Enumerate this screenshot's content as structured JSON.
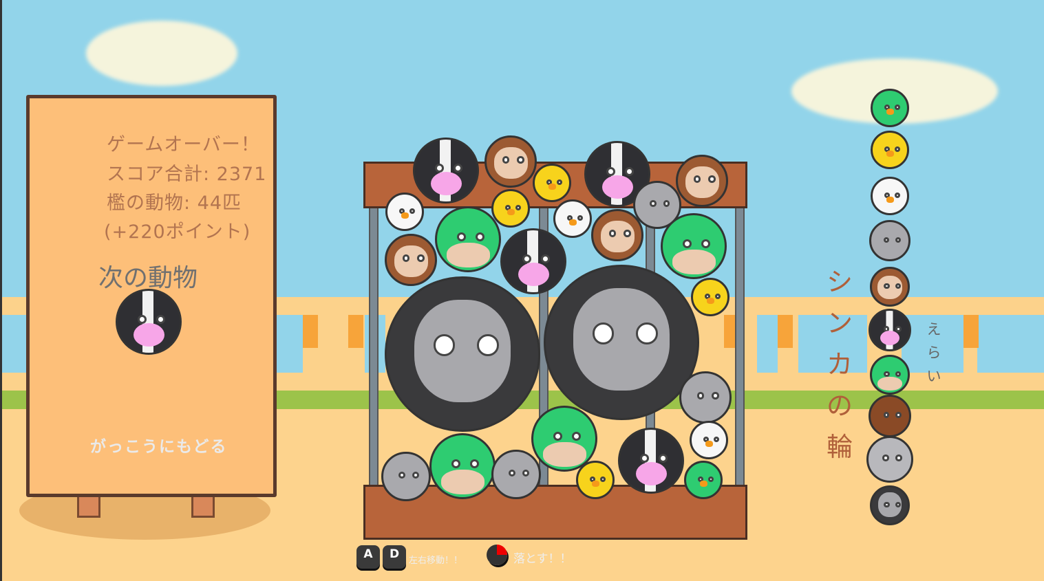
{
  "sign": {
    "game_over": "ゲームオーバー！",
    "score_total": "スコア合計: 2371",
    "cage_animals": "檻の動物: 44匹",
    "bonus": "(+220ポイント)",
    "next_label": "次の動物",
    "next_animal": "cow",
    "back_button": "がっこうにもどる"
  },
  "evolution": {
    "title_chars": [
      "シ",
      "ン",
      "カ",
      "の",
      "輪"
    ],
    "note_chars": [
      "え",
      "ら",
      "い"
    ],
    "chain": [
      "duck",
      "chick",
      "chicken",
      "wolf",
      "sloth",
      "cow",
      "crocodile",
      "bear",
      "elephant",
      "gorilla"
    ]
  },
  "controls": {
    "key_a": "A",
    "key_d": "D",
    "move_hint": "左右移動！！",
    "drop_hint": "落とす！！"
  },
  "cage_animals": [
    "cow",
    "sloth",
    "cow",
    "sloth",
    "chicken",
    "chick",
    "chicken",
    "wolf",
    "chick",
    "crocodile",
    "sloth",
    "cow",
    "sloth",
    "crocodile",
    "gorilla",
    "gorilla",
    "chick",
    "wolf",
    "crocodile",
    "wolf",
    "crocodile",
    "wolf",
    "chick",
    "cow",
    "chicken",
    "duck"
  ],
  "colors": {
    "sign": "#fdbf79",
    "sky": "#92d4ea",
    "ground": "#fdd38d",
    "grass": "#9cc34a"
  }
}
